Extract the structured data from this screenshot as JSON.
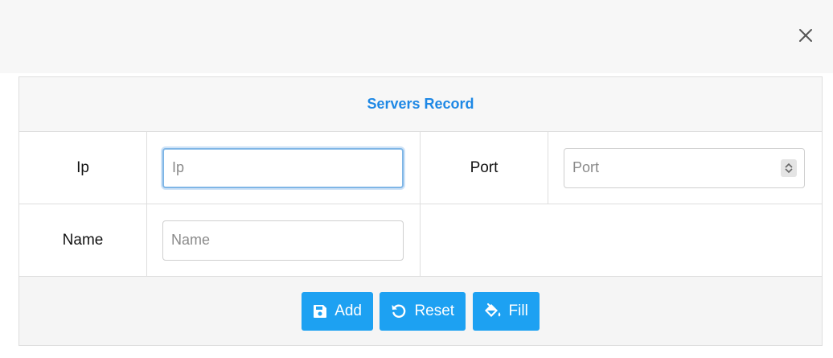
{
  "header": {
    "close_icon": "close-icon"
  },
  "form": {
    "title": "Servers Record",
    "fields": {
      "ip": {
        "label": "Ip",
        "placeholder": "Ip",
        "value": ""
      },
      "port": {
        "label": "Port",
        "placeholder": "Port",
        "value": ""
      },
      "name": {
        "label": "Name",
        "placeholder": "Name",
        "value": ""
      }
    },
    "buttons": {
      "add": {
        "label": "Add",
        "icon": "save-icon"
      },
      "reset": {
        "label": "Reset",
        "icon": "undo-icon"
      },
      "fill": {
        "label": "Fill",
        "icon": "fill-drip-icon"
      }
    }
  },
  "colors": {
    "accent": "#1e88e5",
    "button": "#1da1f2",
    "focus_border": "#7fb6e6",
    "header_bg": "#f7f7f7"
  }
}
